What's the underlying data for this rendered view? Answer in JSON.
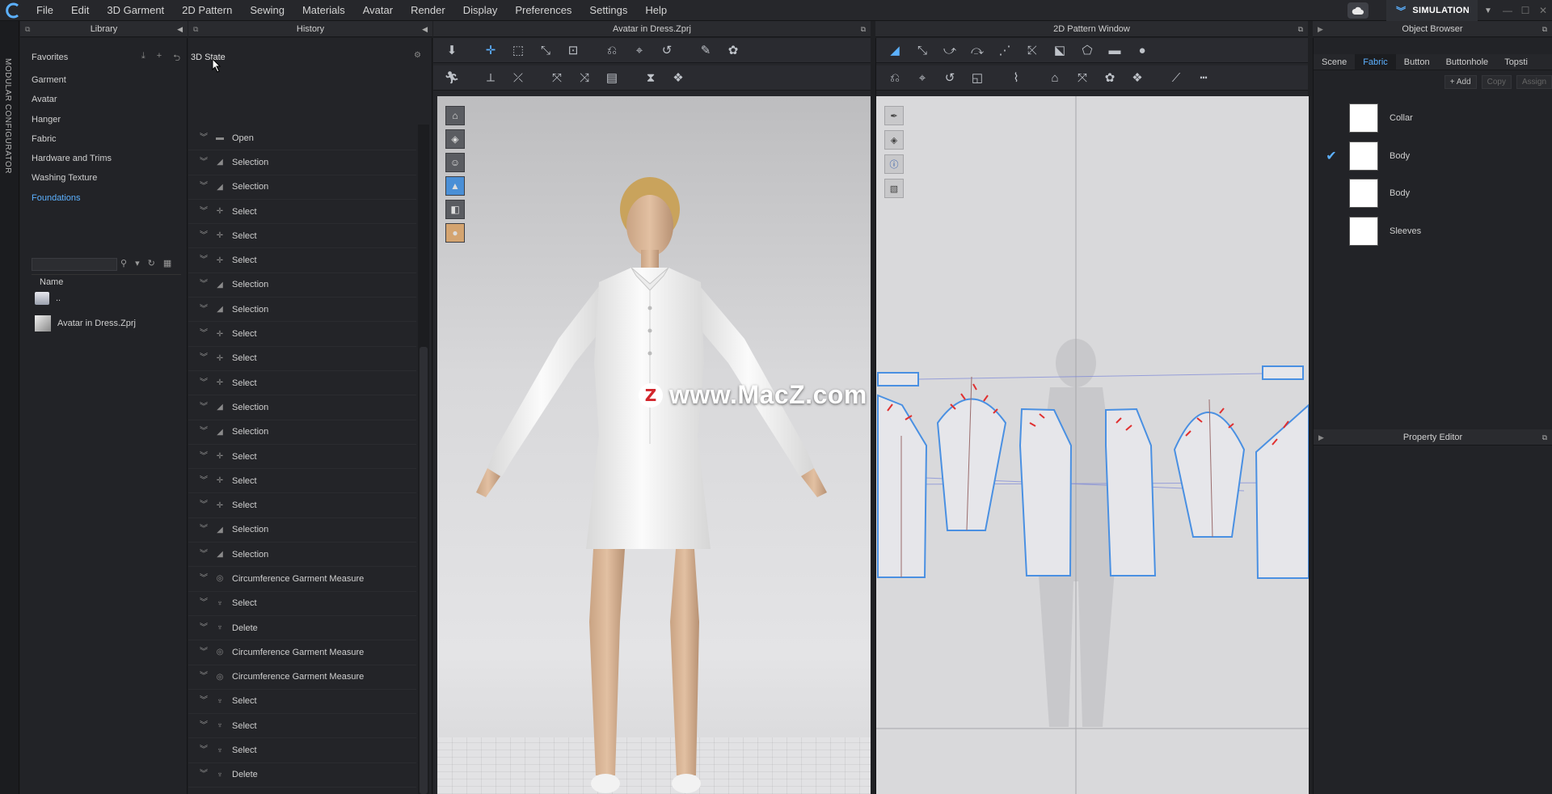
{
  "menu": {
    "items": [
      "File",
      "Edit",
      "3D Garment",
      "2D Pattern",
      "Sewing",
      "Materials",
      "Avatar",
      "Render",
      "Display",
      "Preferences",
      "Settings",
      "Help"
    ],
    "mode": "SIMULATION"
  },
  "sidebar_strip": {
    "label": "MODULAR CONFIGURATOR"
  },
  "library": {
    "title": "Library",
    "favorites": "Favorites",
    "items": [
      {
        "label": "Garment",
        "active": false
      },
      {
        "label": "Avatar",
        "active": false
      },
      {
        "label": "Hanger",
        "active": false
      },
      {
        "label": "Fabric",
        "active": false
      },
      {
        "label": "Hardware and Trims",
        "active": false
      },
      {
        "label": "Washing Texture",
        "active": false
      },
      {
        "label": "Foundations",
        "active": true
      }
    ],
    "search_value": "",
    "column_name": "Name",
    "files": [
      {
        "label": ".."
      },
      {
        "label": "Avatar in Dress.Zprj"
      }
    ]
  },
  "history": {
    "title": "History",
    "state_label": "3D State",
    "entries": [
      {
        "label": "Open",
        "icon": "folder-icon"
      },
      {
        "label": "Selection",
        "icon": "triangle-icon"
      },
      {
        "label": "Selection",
        "icon": "triangle-icon"
      },
      {
        "label": "Select",
        "icon": "move-icon"
      },
      {
        "label": "Select",
        "icon": "move-icon"
      },
      {
        "label": "Select",
        "icon": "move-icon"
      },
      {
        "label": "Selection",
        "icon": "triangle-icon"
      },
      {
        "label": "Selection",
        "icon": "triangle-icon"
      },
      {
        "label": "Select",
        "icon": "move-icon"
      },
      {
        "label": "Select",
        "icon": "move-icon"
      },
      {
        "label": "Select",
        "icon": "move-icon"
      },
      {
        "label": "Selection",
        "icon": "triangle-icon"
      },
      {
        "label": "Selection",
        "icon": "triangle-icon"
      },
      {
        "label": "Select",
        "icon": "move-icon"
      },
      {
        "label": "Select",
        "icon": "move-icon"
      },
      {
        "label": "Select",
        "icon": "move-icon"
      },
      {
        "label": "Selection",
        "icon": "triangle-icon"
      },
      {
        "label": "Selection",
        "icon": "triangle-icon"
      },
      {
        "label": "Circumference Garment Measure",
        "icon": "measure-icon"
      },
      {
        "label": "Select",
        "icon": "shirt-icon"
      },
      {
        "label": "Delete",
        "icon": "shirt-icon"
      },
      {
        "label": "Circumference Garment Measure",
        "icon": "measure-icon"
      },
      {
        "label": "Circumference Garment Measure",
        "icon": "measure-icon"
      },
      {
        "label": "Select",
        "icon": "shirt-icon"
      },
      {
        "label": "Select",
        "icon": "shirt-icon"
      },
      {
        "label": "Select",
        "icon": "shirt-icon"
      },
      {
        "label": "Delete",
        "icon": "shirt-icon"
      }
    ]
  },
  "view3d": {
    "title": "Avatar in Dress.Zprj"
  },
  "view2d": {
    "title": "2D Pattern Window"
  },
  "watermark": {
    "logo": "Z",
    "text": "www.MacZ.com"
  },
  "object_browser": {
    "title": "Object Browser",
    "tabs": [
      {
        "label": "Scene",
        "active": false
      },
      {
        "label": "Fabric",
        "active": true
      },
      {
        "label": "Button",
        "active": false
      },
      {
        "label": "Buttonhole",
        "active": false
      },
      {
        "label": "Topsti",
        "active": false
      }
    ],
    "actions": [
      {
        "label": "+ Add",
        "enabled": true
      },
      {
        "label": "Copy",
        "enabled": false
      },
      {
        "label": "Assign",
        "enabled": false
      }
    ],
    "fabrics": [
      {
        "name": "Collar",
        "checked": false
      },
      {
        "name": "Body",
        "checked": true
      },
      {
        "name": "Body",
        "checked": false
      },
      {
        "name": "Sleeves",
        "checked": false
      }
    ]
  },
  "property_editor": {
    "title": "Property Editor"
  },
  "colors": {
    "accent": "#5cb1ff",
    "panel": "#232428",
    "pattern_outline": "#4a90e2",
    "notch": "#e03030"
  }
}
